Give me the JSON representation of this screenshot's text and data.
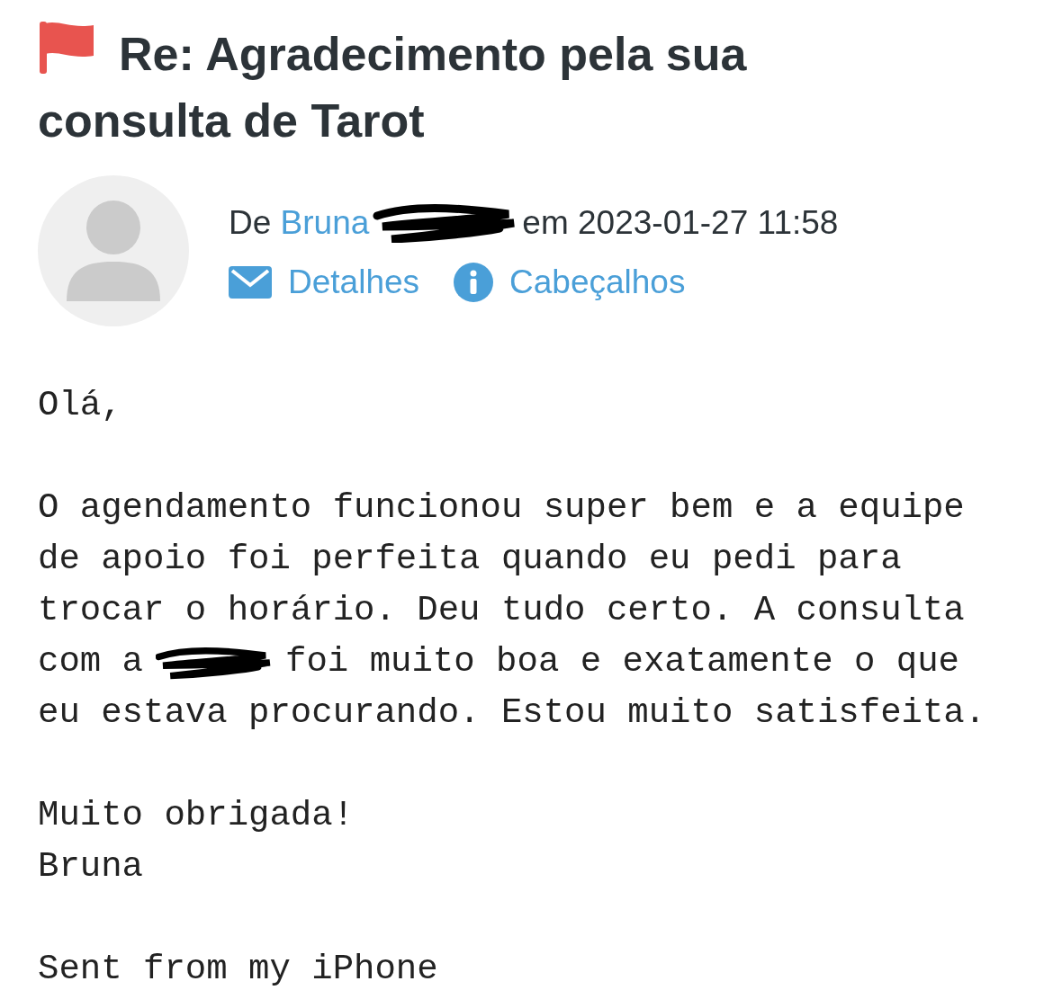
{
  "message": {
    "flagged": true,
    "subject": "Re: Agradecimento pela sua consulta de Tarot",
    "sender": {
      "prefix": "De",
      "name": "Bruna",
      "redacted": true,
      "date": "em 2023-01-27 11:58"
    },
    "actions": [
      {
        "kind": "mail",
        "label": "Detalhes"
      },
      {
        "kind": "info",
        "label": "Cabeçalhos"
      }
    ],
    "body": [
      {
        "lines": [
          {
            "kind": "text",
            "text": "Olá,"
          }
        ]
      },
      {
        "lines": [
          {
            "kind": "text",
            "text": "O agendamento funcionou super bem e a equipe"
          },
          {
            "kind": "text",
            "text": "de apoio foi perfeita quando eu pedi para"
          },
          {
            "kind": "text",
            "text": "trocar o horário. Deu tudo certo. A consulta"
          },
          {
            "kind": "redacted",
            "before": "com a",
            "after": "foi muito boa e exatamente o que"
          },
          {
            "kind": "text",
            "text": "eu estava procurando. Estou muito satisfeita."
          }
        ]
      },
      {
        "lines": [
          {
            "kind": "text",
            "text": "Muito obrigada!"
          },
          {
            "kind": "text",
            "text": "Bruna"
          }
        ]
      },
      {
        "lines": [
          {
            "kind": "text",
            "text": "Sent from my iPhone"
          }
        ]
      }
    ]
  }
}
